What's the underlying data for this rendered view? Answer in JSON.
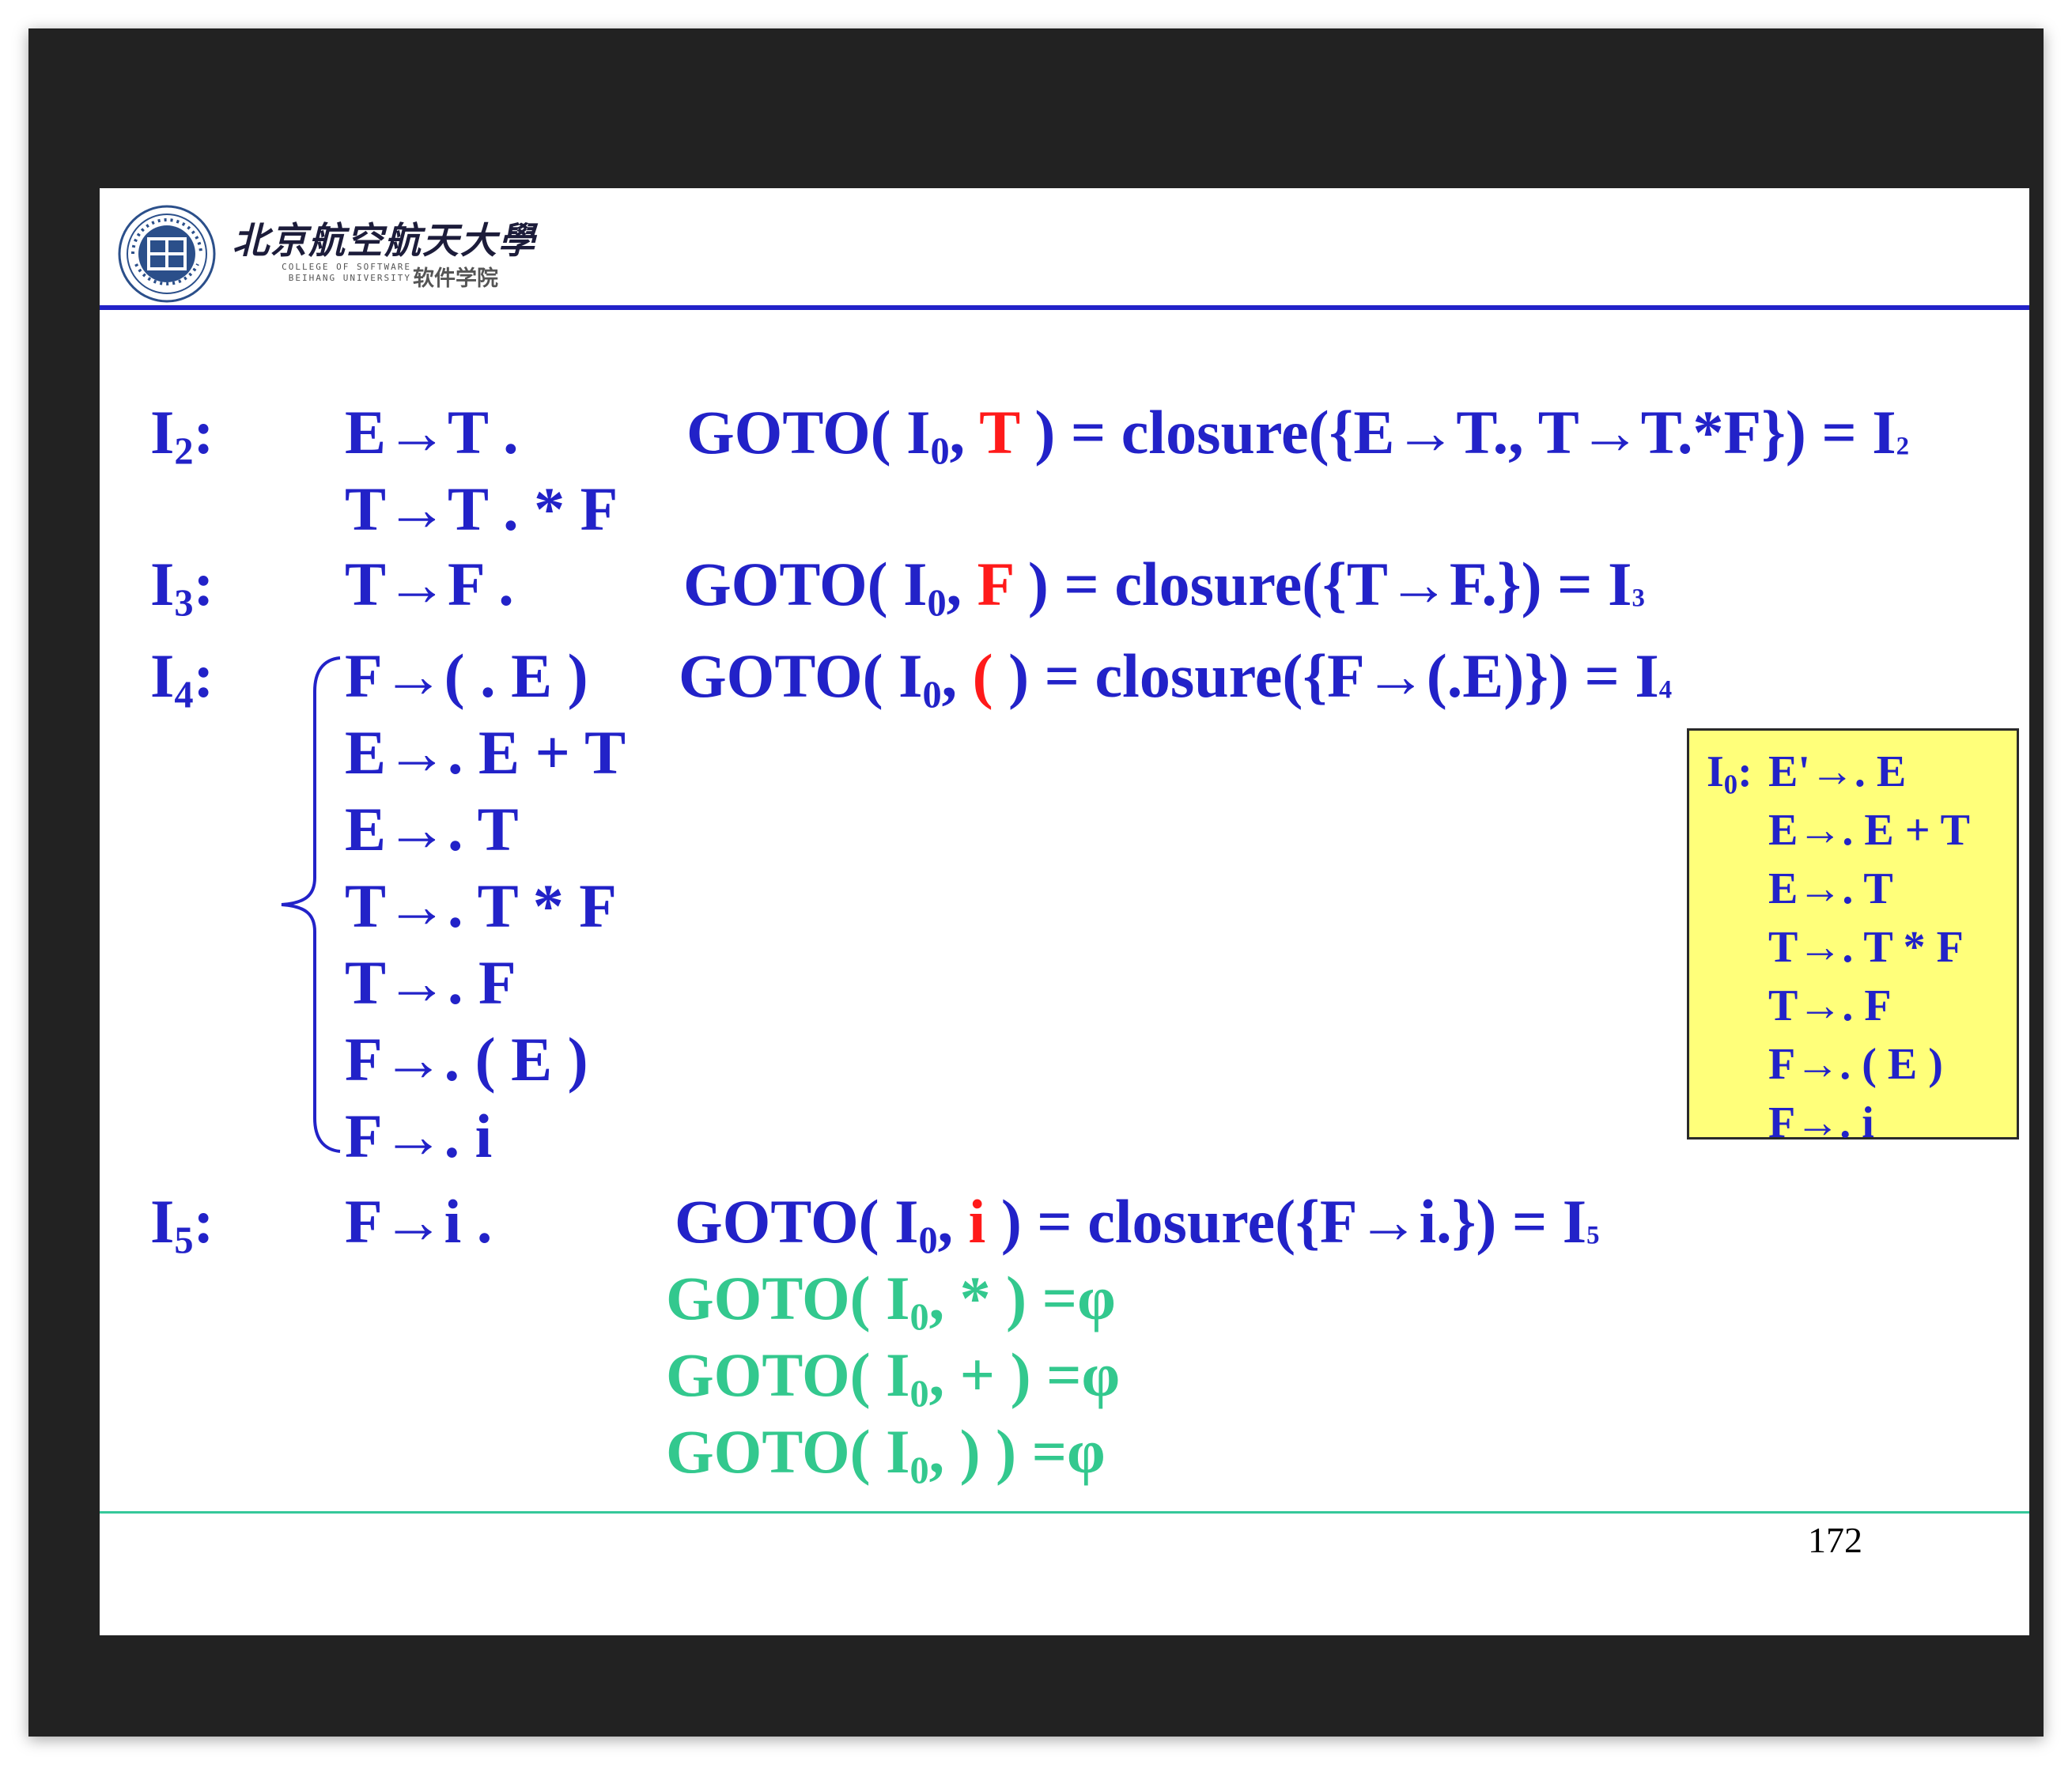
{
  "header": {
    "university_cn": "北京航空航天大學",
    "college_en_line1": "COLLEGE OF SOFTWARE",
    "college_en_line2": "BEIHANG UNIVERSITY",
    "college_cn": "软件学院",
    "seal_text": "北京航空航天大学",
    "seal_inner": "软件"
  },
  "sets": [
    {
      "name": "I",
      "num": "2",
      "colon": ":",
      "items": [
        "E→T .",
        "T→T . * F"
      ],
      "goto": {
        "pre": "GOTO( I",
        "sub": "0",
        "comma": ",",
        "sym": "T",
        "post": ") = closure({E→T., T→T.*F}) = I",
        "res": "2"
      }
    },
    {
      "name": "I",
      "num": "3",
      "colon": ":",
      "items": [
        "T→F ."
      ],
      "goto": {
        "pre": "GOTO( I",
        "sub": "0",
        "comma": ",",
        "sym": "F",
        "post": ") = closure({T→F.}) = I",
        "res": "3"
      }
    },
    {
      "name": "I",
      "num": "4",
      "colon": ":",
      "items": [
        "F→( . E )",
        "E→. E + T",
        "E→. T",
        "T→. T * F",
        "T→. F",
        "F→. ( E )",
        "F→. i"
      ],
      "goto": {
        "pre": "GOTO( I",
        "sub": "0",
        "comma": ",",
        "sym": "(",
        "post": ") = closure({F→(.E)}) = I",
        "res": "4"
      }
    },
    {
      "name": "I",
      "num": "5",
      "colon": ":",
      "items": [
        "F→i ."
      ],
      "goto": {
        "pre": "GOTO( I",
        "sub": "0",
        "comma": ",",
        "sym": "i",
        "post": ") = closure({F→i.}) = I",
        "res": "5"
      }
    }
  ],
  "empty_gotos": [
    {
      "pre": "GOTO( I",
      "sub": "0",
      "rest": ", * ) =φ"
    },
    {
      "pre": "GOTO( I",
      "sub": "0",
      "rest": ", + ) =φ"
    },
    {
      "pre": "GOTO( I",
      "sub": "0",
      "rest": ", ) ) =φ"
    }
  ],
  "i0_box": {
    "name": "I",
    "sub": "0",
    "colon": ":",
    "items": [
      "E'→. E",
      "E→. E + T",
      "E→. T",
      "T→. T * F",
      "T→. F",
      "F→. ( E )",
      "F→. i"
    ]
  },
  "page_number": "172",
  "colors": {
    "blue": "#2222c8",
    "red": "#ff1a1a",
    "green": "#33c88e",
    "box_bg": "#ffff7a",
    "header_rule": "#2222c8",
    "footer_rule": "#35c89a"
  }
}
